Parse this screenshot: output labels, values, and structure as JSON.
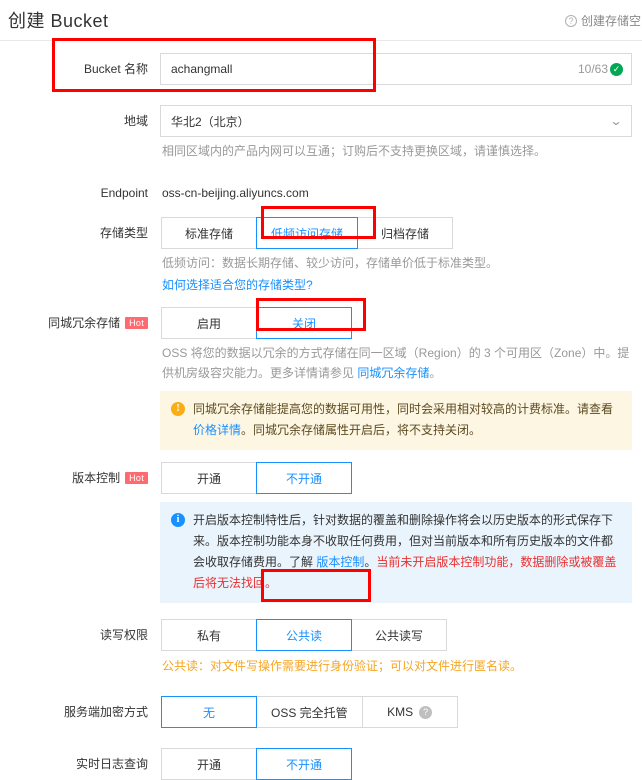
{
  "header": {
    "title": "创建 Bucket",
    "help_label": "创建存储空间",
    "help_icon": "question-circle-icon"
  },
  "form": {
    "bucket_name": {
      "label": "Bucket 名称",
      "value": "achangmall",
      "placeholder": "",
      "counter": "10/63",
      "valid_icon": "check-circle-icon"
    },
    "region": {
      "label": "地域",
      "value": "华北2（北京）",
      "chevron": "chevron-down-icon",
      "hint": "相同区域内的产品内网可以互通；订购后不支持更换区域，请谨慎选择。"
    },
    "endpoint": {
      "label": "Endpoint",
      "value": "oss-cn-beijing.aliyuncs.com"
    },
    "storage_class": {
      "label": "存储类型",
      "options": [
        "标准存储",
        "低频访问存储",
        "归档存储"
      ],
      "selected": "低频访问存储",
      "hint": "低频访问：数据长期存储、较少访问，存储单价低于标准类型。",
      "link": "如何选择适合您的存储类型?"
    },
    "zone_redundancy": {
      "label": "同城冗余存储",
      "badge": "Hot",
      "options": [
        "启用",
        "关闭"
      ],
      "selected": "关闭",
      "hint_part1": "OSS 将您的数据以冗余的方式存储在同一区域（Region）的 3 个可用区（Zone）中。提供机房级容灾能力。更多详情请参见 ",
      "hint_link": "同城冗余存储",
      "hint_part2": "。",
      "alert_icon": "warning-icon",
      "alert_part1": "同城冗余存储能提高您的数据可用性，同时会采用相对较高的计费标准。请查看 ",
      "alert_link": "价格详情",
      "alert_part2": "。同城冗余存储属性开启后，将不支持关闭。"
    },
    "versioning": {
      "label": "版本控制",
      "badge": "Hot",
      "options": [
        "开通",
        "不开通"
      ],
      "selected": "不开通",
      "alert_icon": "info-icon",
      "alert_part1": "开启版本控制特性后，针对数据的覆盖和删除操作将会以历史版本的形式保存下来。版本控制功能本身不收取任何费用，但对当前版本和所有历史版本的文件都会收取存储费用。了解 ",
      "alert_link": "版本控制",
      "alert_part2": "。",
      "alert_danger": "当前未开启版本控制功能，数据删除或被覆盖后将无法找回。"
    },
    "acl": {
      "label": "读写权限",
      "options": [
        "私有",
        "公共读",
        "公共读写"
      ],
      "selected": "公共读",
      "hint": "公共读：对文件写操作需要进行身份验证；可以对文件进行匿名读。"
    },
    "sse": {
      "label": "服务端加密方式",
      "options": [
        "无",
        "OSS 完全托管",
        "KMS"
      ],
      "selected": "无",
      "kms_help_icon": "question-circle-icon"
    },
    "realtime_log": {
      "label": "实时日志查询",
      "options": [
        "开通",
        "不开通"
      ],
      "selected": "不开通"
    }
  },
  "annotations": {
    "count": 4,
    "color": "#ff0000",
    "targets": [
      "bucket-name-row",
      "storage-class-low-frequency",
      "zone-redundancy-off",
      "acl-public-read"
    ]
  }
}
